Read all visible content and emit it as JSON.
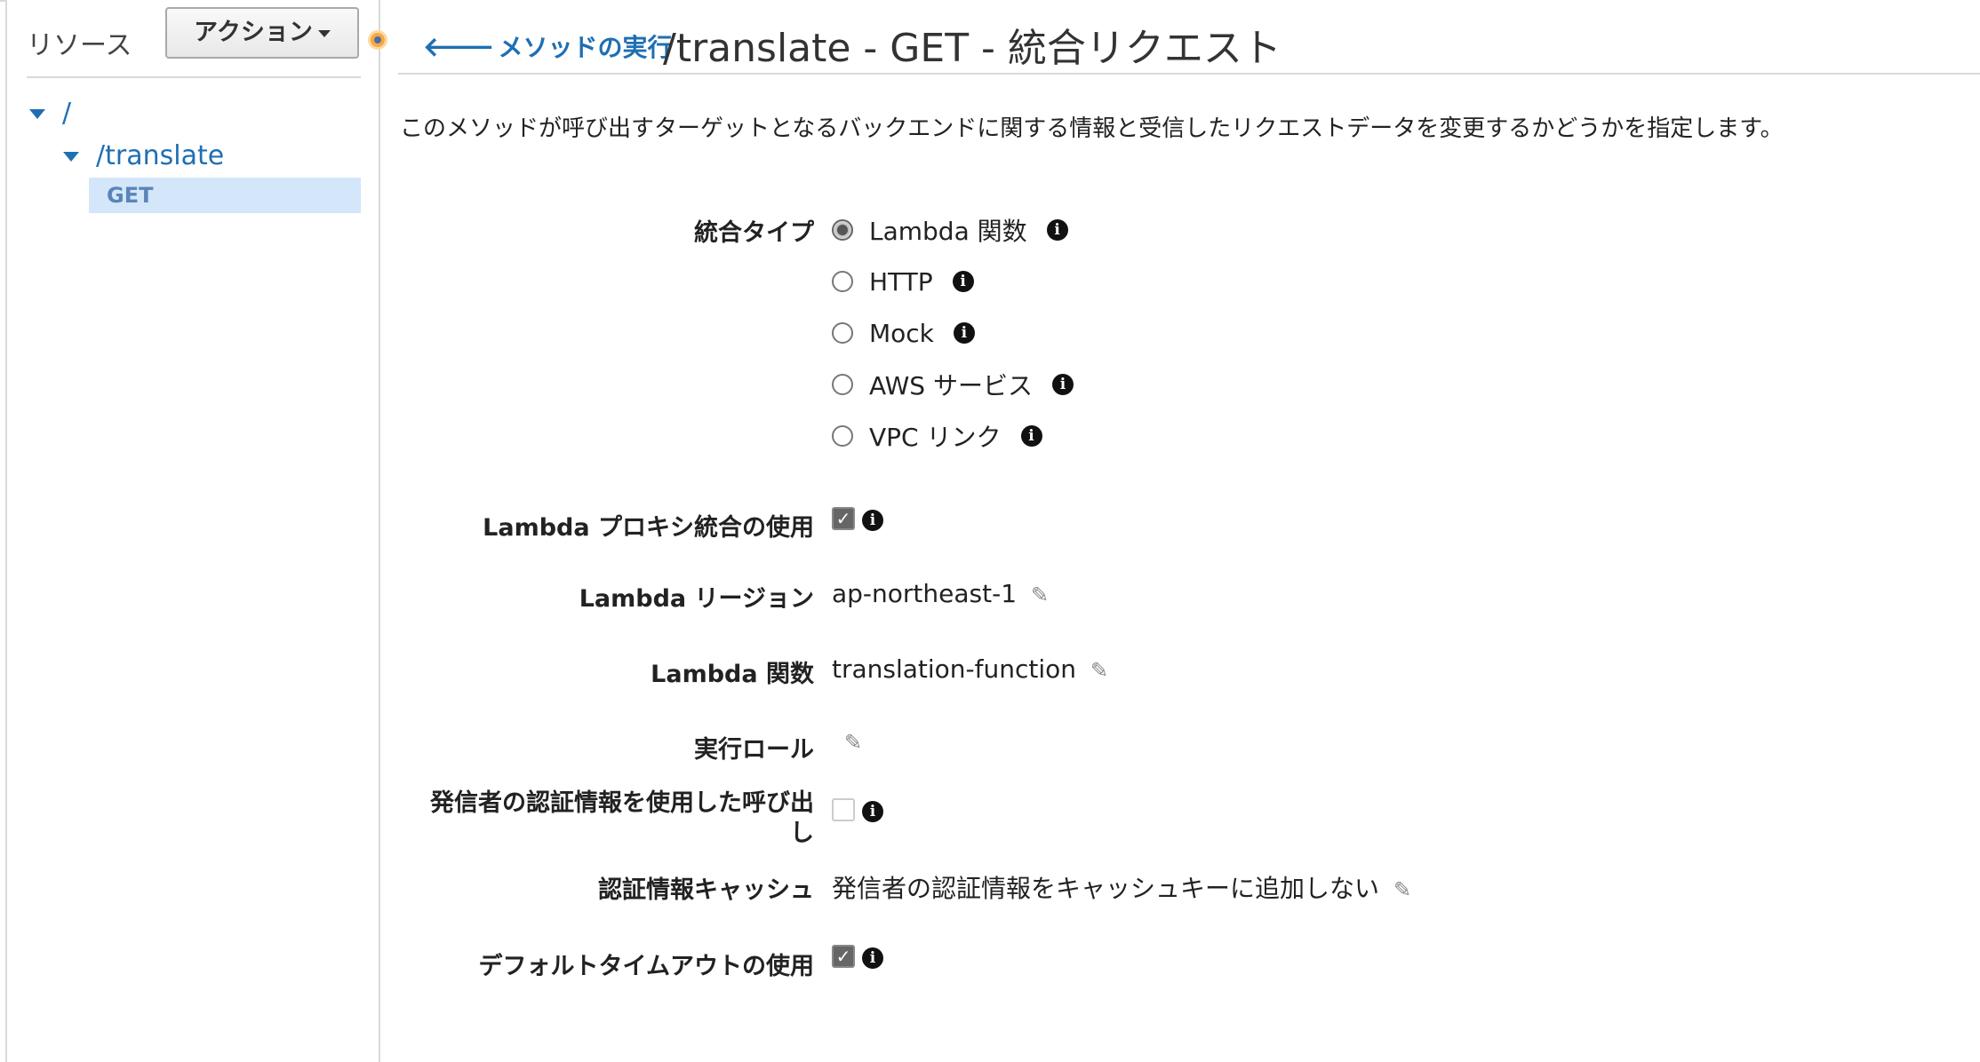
{
  "sidebar": {
    "header": "リソース",
    "actions_label": "アクション",
    "tree": {
      "root": "/",
      "translate": "/translate",
      "get": "GET"
    }
  },
  "header": {
    "back_link": "メソッドの実行",
    "title": "/translate - GET - 統合リクエスト"
  },
  "description": "このメソッドが呼び出すターゲットとなるバックエンドに関する情報と受信したリクエストデータを変更するかどうかを指定します。",
  "form": {
    "integration_type": {
      "label": "統合タイプ",
      "options": [
        {
          "label": "Lambda 関数",
          "checked": true
        },
        {
          "label": "HTTP",
          "checked": false
        },
        {
          "label": "Mock",
          "checked": false
        },
        {
          "label": "AWS サービス",
          "checked": false
        },
        {
          "label": "VPC リンク",
          "checked": false
        }
      ]
    },
    "proxy": {
      "label": "Lambda プロキシ統合の使用",
      "checked": true
    },
    "region": {
      "label": "Lambda リージョン",
      "value": "ap-northeast-1"
    },
    "function": {
      "label": "Lambda 関数",
      "value": "translation-function"
    },
    "role": {
      "label": "実行ロール",
      "value": ""
    },
    "caller_credentials": {
      "label_line1": "発信者の認証情報を使用した呼び出",
      "label_line2": "し",
      "checked": false
    },
    "credentials_cache": {
      "label": "認証情報キャッシュ",
      "value": "発信者の認証情報をキャッシュキーに追加しない"
    },
    "default_timeout": {
      "label": "デフォルトタイムアウトの使用",
      "checked": true
    }
  },
  "icons": {
    "info": "i",
    "pencil": "✎",
    "check": "✓",
    "back_arrow": "🡐"
  }
}
